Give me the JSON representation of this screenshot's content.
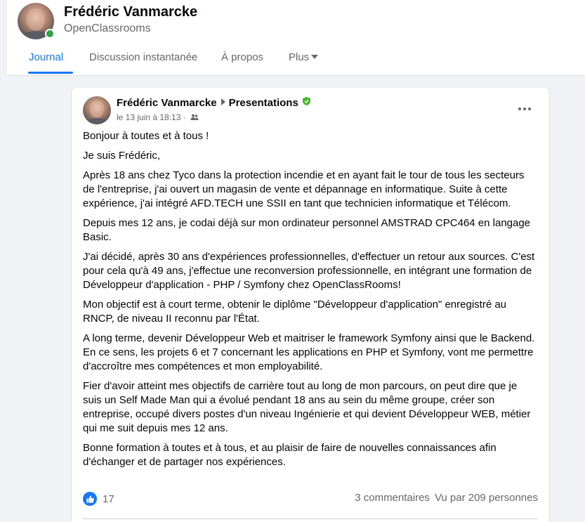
{
  "profile": {
    "name": "Frédéric Vanmarcke",
    "group": "OpenClassrooms",
    "tabs": [
      {
        "label": "Journal",
        "active": true
      },
      {
        "label": "Discussion instantanée",
        "active": false
      },
      {
        "label": "À propos",
        "active": false
      },
      {
        "label": "Plus",
        "active": false
      }
    ]
  },
  "post": {
    "author": "Frédéric Vanmarcke",
    "destination": "Presentations",
    "timestamp": "le 13 juin à 18:13",
    "separator": "·",
    "paragraphs": [
      "Bonjour à toutes et à tous !",
      "Je suis Frédéric,",
      "Après 18 ans chez Tyco dans la protection incendie et en ayant fait le tour de tous les secteurs de l'entreprise, j'ai ouvert un magasin de vente et dépannage en informatique. Suite à cette expérience, j'ai intégré AFD.TECH une SSII en tant que technicien informatique et Télécom.",
      "Depuis mes 12 ans, je codai déjà sur mon ordinateur personnel AMSTRAD CPC464 en langage Basic.",
      "J'ai décidé, après 30 ans d'expériences professionnelles, d'effectuer un retour aux sources. C'est pour cela qu'à 49 ans, j'effectue une reconversion professionnelle, en intégrant une formation de Développeur d'application - PHP / Symfony chez OpenClassRooms!",
      "Mon objectif est à court terme, obtenir le diplôme \"Développeur d'application\" enregistré au RNCP, de niveau II reconnu par l'État.",
      "A long terme, devenir Développeur Web et maitriser le framework Symfony ainsi que le Backend. En ce sens, les projets 6 et 7 concernant les applications en PHP et Symfony, vont me permettre d'accroître mes compétences et mon employabilité.",
      "Fier d'avoir atteint mes objectifs de carrière tout au long de mon parcours, on peut dire que je suis un Self Made Man qui a évolué pendant 18 ans au sein du même groupe, créer son entreprise, occupé divers postes d'un niveau Ingénierie et qui devient Développeur WEB, métier qui me suit depuis mes 12 ans.",
      "Bonne formation à toutes et à tous, et au plaisir de faire de nouvelles connaissances afin d'échanger et de partager nos expériences."
    ],
    "reaction_count": "17",
    "comments": "3 commentaires",
    "views": "Vu par 209 personnes"
  },
  "colors": {
    "accent": "#1877f2",
    "online": "#31a24c",
    "secondary_text": "#65676b",
    "admin_badge": "#42b72a"
  },
  "icons": [
    "caret-down-icon",
    "arrow-right-icon",
    "admin-shield-icon",
    "group-audience-icon",
    "more-icon",
    "like-icon"
  ]
}
